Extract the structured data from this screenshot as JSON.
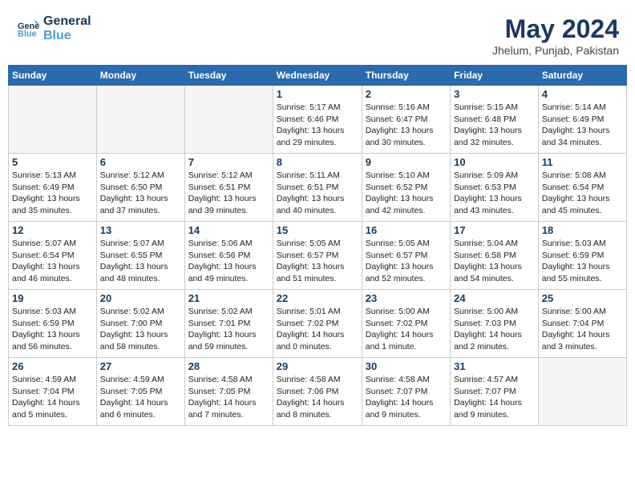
{
  "header": {
    "logo_line1": "General",
    "logo_line2": "Blue",
    "main_title": "May 2024",
    "subtitle": "Jhelum, Punjab, Pakistan"
  },
  "calendar": {
    "days_of_week": [
      "Sunday",
      "Monday",
      "Tuesday",
      "Wednesday",
      "Thursday",
      "Friday",
      "Saturday"
    ],
    "weeks": [
      [
        {
          "day": "",
          "info": ""
        },
        {
          "day": "",
          "info": ""
        },
        {
          "day": "",
          "info": ""
        },
        {
          "day": "1",
          "info": "Sunrise: 5:17 AM\nSunset: 6:46 PM\nDaylight: 13 hours\nand 29 minutes."
        },
        {
          "day": "2",
          "info": "Sunrise: 5:16 AM\nSunset: 6:47 PM\nDaylight: 13 hours\nand 30 minutes."
        },
        {
          "day": "3",
          "info": "Sunrise: 5:15 AM\nSunset: 6:48 PM\nDaylight: 13 hours\nand 32 minutes."
        },
        {
          "day": "4",
          "info": "Sunrise: 5:14 AM\nSunset: 6:49 PM\nDaylight: 13 hours\nand 34 minutes."
        }
      ],
      [
        {
          "day": "5",
          "info": "Sunrise: 5:13 AM\nSunset: 6:49 PM\nDaylight: 13 hours\nand 35 minutes."
        },
        {
          "day": "6",
          "info": "Sunrise: 5:12 AM\nSunset: 6:50 PM\nDaylight: 13 hours\nand 37 minutes."
        },
        {
          "day": "7",
          "info": "Sunrise: 5:12 AM\nSunset: 6:51 PM\nDaylight: 13 hours\nand 39 minutes."
        },
        {
          "day": "8",
          "info": "Sunrise: 5:11 AM\nSunset: 6:51 PM\nDaylight: 13 hours\nand 40 minutes."
        },
        {
          "day": "9",
          "info": "Sunrise: 5:10 AM\nSunset: 6:52 PM\nDaylight: 13 hours\nand 42 minutes."
        },
        {
          "day": "10",
          "info": "Sunrise: 5:09 AM\nSunset: 6:53 PM\nDaylight: 13 hours\nand 43 minutes."
        },
        {
          "day": "11",
          "info": "Sunrise: 5:08 AM\nSunset: 6:54 PM\nDaylight: 13 hours\nand 45 minutes."
        }
      ],
      [
        {
          "day": "12",
          "info": "Sunrise: 5:07 AM\nSunset: 6:54 PM\nDaylight: 13 hours\nand 46 minutes."
        },
        {
          "day": "13",
          "info": "Sunrise: 5:07 AM\nSunset: 6:55 PM\nDaylight: 13 hours\nand 48 minutes."
        },
        {
          "day": "14",
          "info": "Sunrise: 5:06 AM\nSunset: 6:56 PM\nDaylight: 13 hours\nand 49 minutes."
        },
        {
          "day": "15",
          "info": "Sunrise: 5:05 AM\nSunset: 6:57 PM\nDaylight: 13 hours\nand 51 minutes."
        },
        {
          "day": "16",
          "info": "Sunrise: 5:05 AM\nSunset: 6:57 PM\nDaylight: 13 hours\nand 52 minutes."
        },
        {
          "day": "17",
          "info": "Sunrise: 5:04 AM\nSunset: 6:58 PM\nDaylight: 13 hours\nand 54 minutes."
        },
        {
          "day": "18",
          "info": "Sunrise: 5:03 AM\nSunset: 6:59 PM\nDaylight: 13 hours\nand 55 minutes."
        }
      ],
      [
        {
          "day": "19",
          "info": "Sunrise: 5:03 AM\nSunset: 6:59 PM\nDaylight: 13 hours\nand 56 minutes."
        },
        {
          "day": "20",
          "info": "Sunrise: 5:02 AM\nSunset: 7:00 PM\nDaylight: 13 hours\nand 58 minutes."
        },
        {
          "day": "21",
          "info": "Sunrise: 5:02 AM\nSunset: 7:01 PM\nDaylight: 13 hours\nand 59 minutes."
        },
        {
          "day": "22",
          "info": "Sunrise: 5:01 AM\nSunset: 7:02 PM\nDaylight: 14 hours\nand 0 minutes."
        },
        {
          "day": "23",
          "info": "Sunrise: 5:00 AM\nSunset: 7:02 PM\nDaylight: 14 hours\nand 1 minute."
        },
        {
          "day": "24",
          "info": "Sunrise: 5:00 AM\nSunset: 7:03 PM\nDaylight: 14 hours\nand 2 minutes."
        },
        {
          "day": "25",
          "info": "Sunrise: 5:00 AM\nSunset: 7:04 PM\nDaylight: 14 hours\nand 3 minutes."
        }
      ],
      [
        {
          "day": "26",
          "info": "Sunrise: 4:59 AM\nSunset: 7:04 PM\nDaylight: 14 hours\nand 5 minutes."
        },
        {
          "day": "27",
          "info": "Sunrise: 4:59 AM\nSunset: 7:05 PM\nDaylight: 14 hours\nand 6 minutes."
        },
        {
          "day": "28",
          "info": "Sunrise: 4:58 AM\nSunset: 7:05 PM\nDaylight: 14 hours\nand 7 minutes."
        },
        {
          "day": "29",
          "info": "Sunrise: 4:58 AM\nSunset: 7:06 PM\nDaylight: 14 hours\nand 8 minutes."
        },
        {
          "day": "30",
          "info": "Sunrise: 4:58 AM\nSunset: 7:07 PM\nDaylight: 14 hours\nand 9 minutes."
        },
        {
          "day": "31",
          "info": "Sunrise: 4:57 AM\nSunset: 7:07 PM\nDaylight: 14 hours\nand 9 minutes."
        },
        {
          "day": "",
          "info": ""
        }
      ]
    ]
  }
}
